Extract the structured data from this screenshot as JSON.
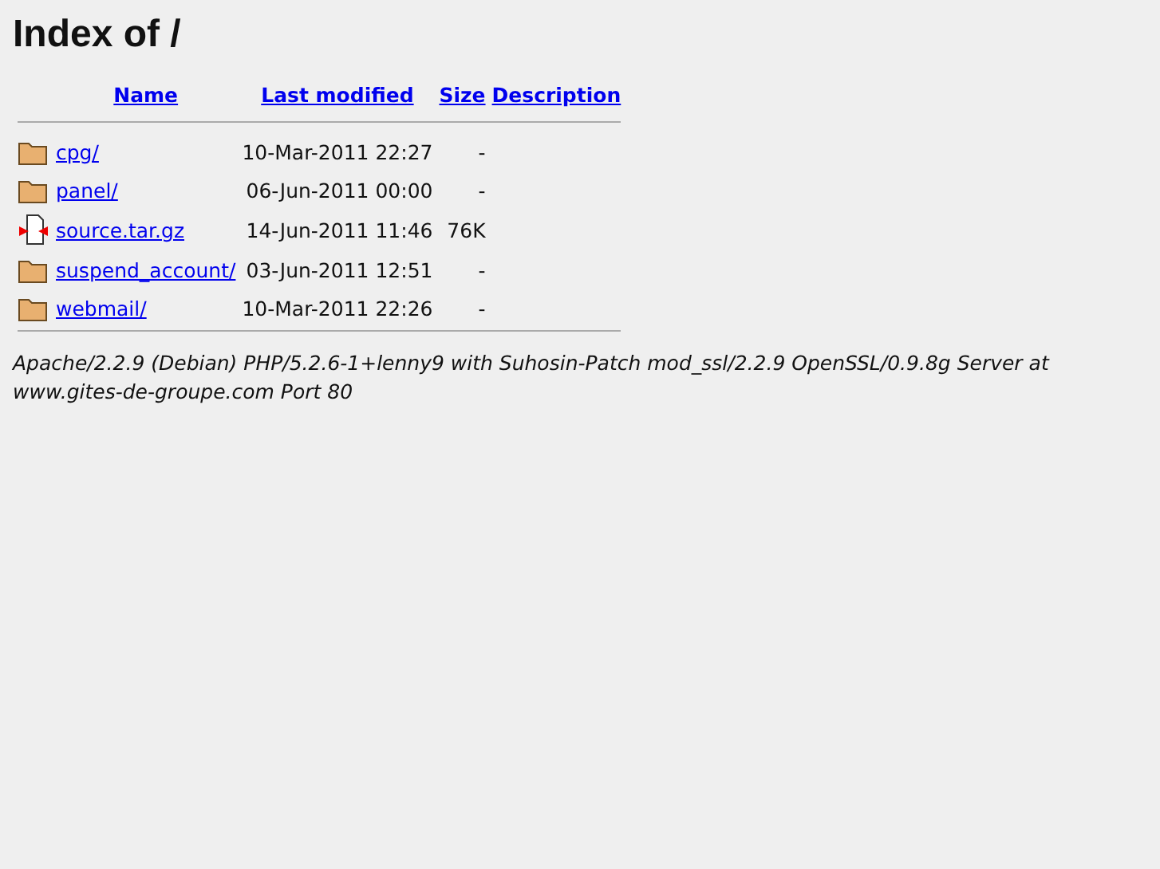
{
  "title": "Index of /",
  "columns": [
    "Name",
    "Last modified",
    "Size",
    "Description"
  ],
  "rows": [
    {
      "kind": "folder",
      "name": "cpg/",
      "modified": "10-Mar-2011 22:27",
      "size": "-"
    },
    {
      "kind": "folder",
      "name": "panel/",
      "modified": "06-Jun-2011 00:00",
      "size": "-"
    },
    {
      "kind": "archive",
      "name": "source.tar.gz",
      "modified": "14-Jun-2011 11:46",
      "size": "76K"
    },
    {
      "kind": "folder",
      "name": "suspend_account/",
      "modified": "03-Jun-2011 12:51",
      "size": "-"
    },
    {
      "kind": "folder",
      "name": "webmail/",
      "modified": "10-Mar-2011 22:26",
      "size": "-"
    }
  ],
  "footer": "Apache/2.2.9 (Debian) PHP/5.2.6-1+lenny9 with Suhosin-Patch mod_ssl/2.2.9 OpenSSL/0.9.8g Server at www.gites-de-groupe.com Port 80"
}
